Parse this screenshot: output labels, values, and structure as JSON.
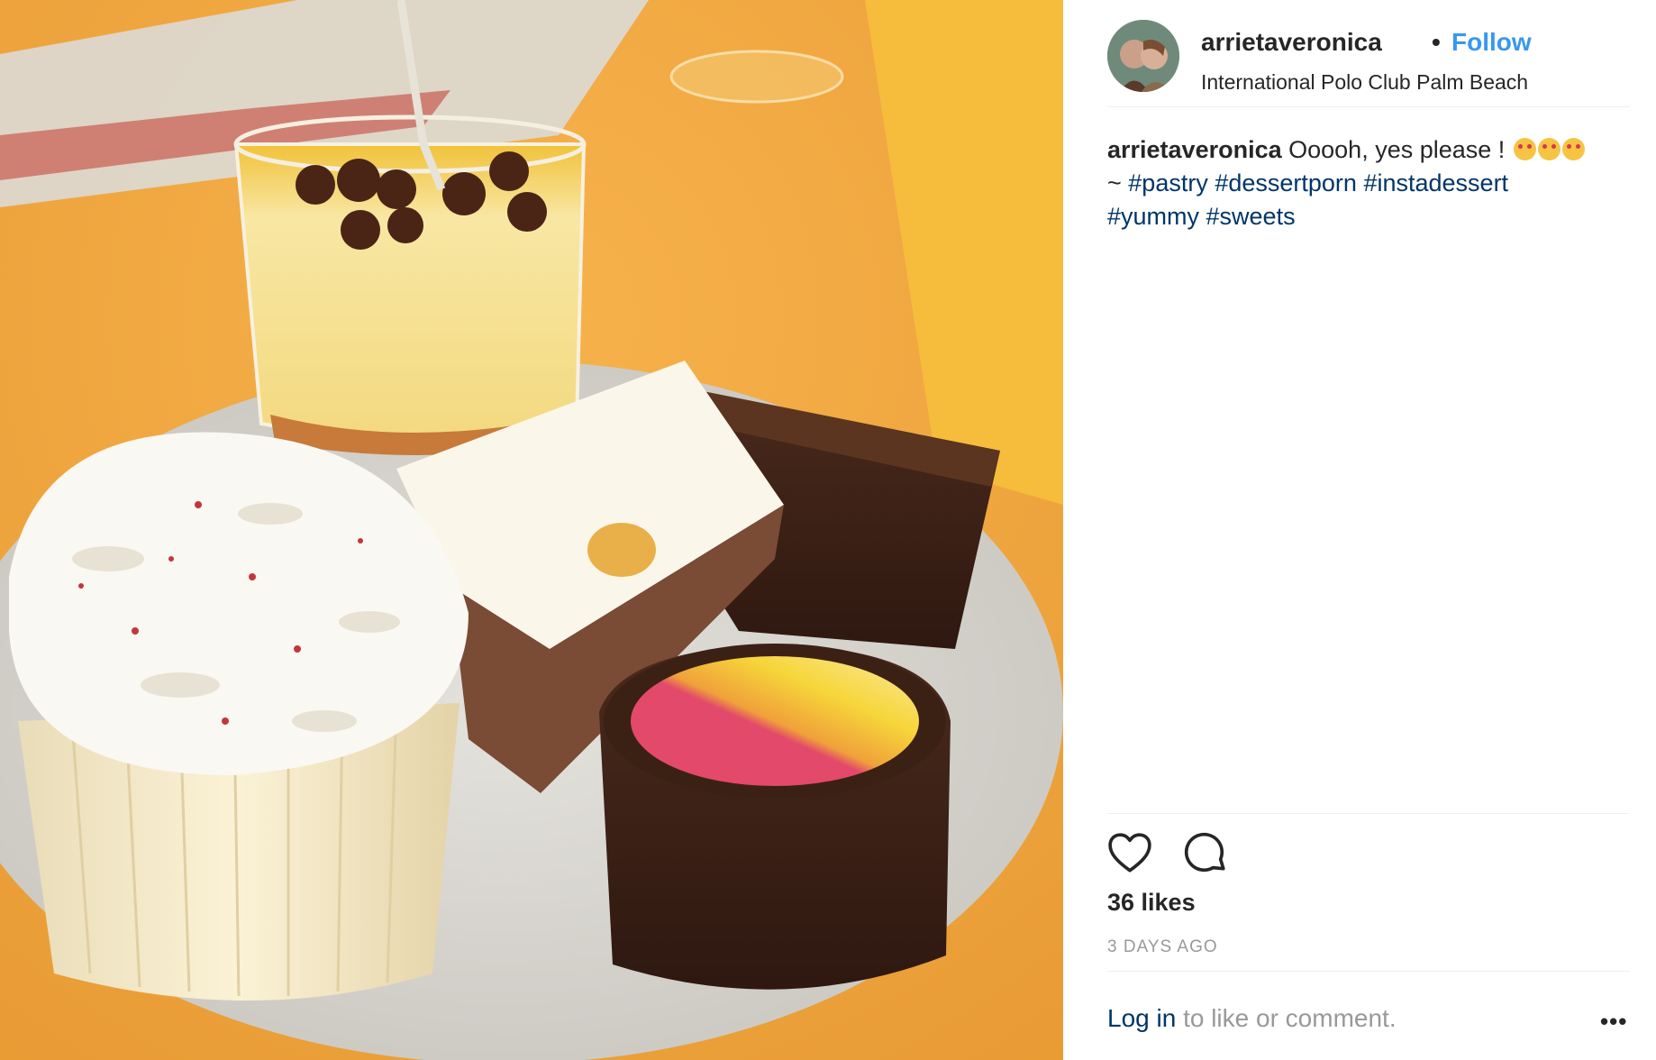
{
  "post": {
    "username": "arrietaveronica",
    "separator": "•",
    "follow_label": "Follow",
    "location": "International Polo Club Palm Beach",
    "caption": {
      "username": "arrietaveronica",
      "text": " Ooooh, yes please ! ",
      "emoji_icons": [
        "heart-eyes-emoji",
        "smiling-emoji",
        "smiling-emoji"
      ],
      "prefix": "~ ",
      "hashtags": [
        "#pastry",
        "#dessertporn",
        "#instadessert",
        "#yummy",
        "#sweets"
      ]
    },
    "likes": "36 likes",
    "time_ago": "3 DAYS AGO",
    "login_link": "Log in",
    "login_text": " to like or comment.",
    "more_label": "•••",
    "icons": {
      "like": "heart-outline-icon",
      "comment": "speech-bubble-icon"
    },
    "colors": {
      "follow": "#3897f0",
      "hashtag": "#003569",
      "muted": "#999999",
      "text": "#262626"
    }
  }
}
